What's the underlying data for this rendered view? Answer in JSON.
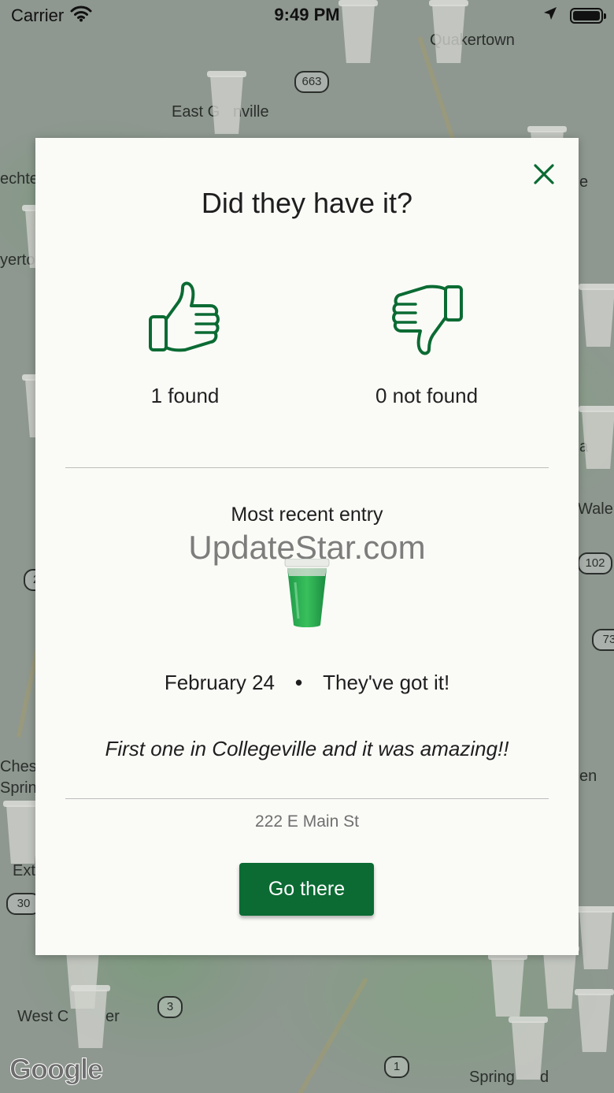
{
  "status_bar": {
    "carrier": "Carrier",
    "time": "9:49 PM",
    "icons": [
      "wifi-icon",
      "location-arrow-icon",
      "battery-icon"
    ]
  },
  "map": {
    "labels": [
      "Quakertown",
      "East G",
      "nville",
      "echte",
      "yerto",
      "Wale",
      "Chest",
      "Sprin",
      "en",
      "Ext",
      "West C",
      "er",
      "Spring",
      "d",
      "a",
      "e"
    ],
    "route_badges": [
      "663",
      "102",
      "73",
      "30",
      "3",
      "1",
      "2"
    ],
    "attribution": "Google"
  },
  "modal": {
    "close_icon": "close-icon",
    "title": "Did they have it?",
    "found": {
      "icon": "thumbs-up-icon",
      "label": "1 found"
    },
    "not_found": {
      "icon": "thumbs-down-icon",
      "label": "0 not found"
    },
    "recent_heading": "Most recent entry",
    "watermark": "UpdateStar.com",
    "entry": {
      "date": "February 24",
      "separator": "•",
      "status": "They've got it!",
      "comment": "First one in Collegeville and it was amazing!!"
    },
    "address": "222 E Main St",
    "go_button_label": "Go there"
  },
  "colors": {
    "accent": "#0b6b33",
    "modal_background": "#fafbf7",
    "map_background": "#8e9790"
  }
}
